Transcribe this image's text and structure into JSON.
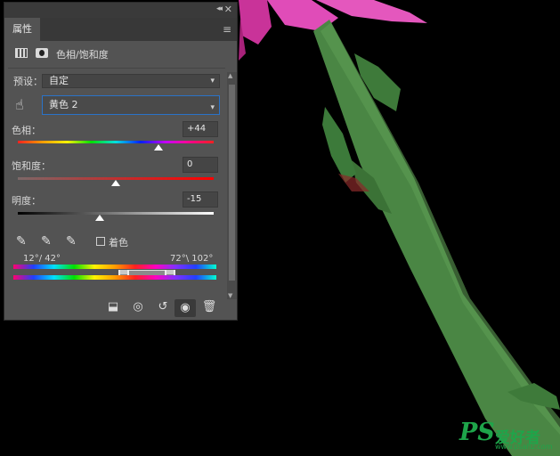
{
  "panel": {
    "tab_label": "属性",
    "collapse_glyph": "◂◂",
    "close_glyph": "✕",
    "menu_glyph": "≡",
    "adjustment_title": "色相/饱和度",
    "preset": {
      "label": "预设：",
      "value": "自定"
    },
    "channel": {
      "value": "黄色 2"
    },
    "hue": {
      "label": "色相：",
      "value": "+44",
      "fraction": 0.72
    },
    "saturation": {
      "label": "饱和度：",
      "value": "0",
      "fraction": 0.5
    },
    "lightness": {
      "label": "明度：",
      "value": "-15",
      "fraction": 0.42
    },
    "colorize_label": "着色",
    "range_left": "12°/ 42°",
    "range_right": "72°\\ 102°",
    "icons": {
      "hand": "targeted-adjustment-hand-icon",
      "eyedroppers": [
        "eyedropper-icon",
        "eyedropper-add-icon",
        "eyedropper-subtract-icon"
      ],
      "bottom": [
        "clip-to-layer-icon",
        "view-previous-state-icon",
        "reset-icon",
        "visibility-eye-icon",
        "delete-trash-icon"
      ]
    }
  },
  "colors": {
    "panel_bg": "#535353",
    "accent_focus": "#2a73c8",
    "stem_green": "#4e8a45",
    "petal_pink": "#e23fae"
  },
  "watermark": {
    "logo": "PS",
    "brand": "爱好者",
    "url": "www.psahz.com"
  }
}
